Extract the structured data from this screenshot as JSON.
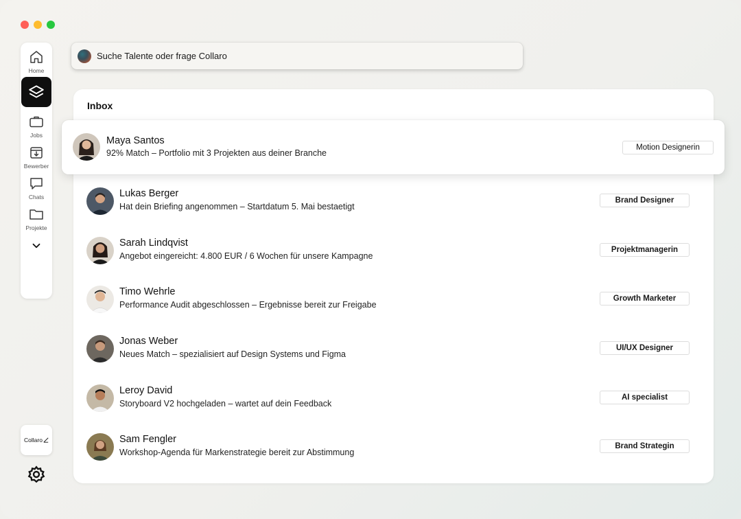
{
  "search": {
    "placeholder": "Suche Talente oder frage Collaro"
  },
  "sidebar": {
    "items": [
      {
        "label": "Home",
        "icon": "home-icon"
      },
      {
        "label": "",
        "icon": "layers-icon",
        "active": true
      },
      {
        "label": "Jobs",
        "icon": "briefcase-icon"
      },
      {
        "label": "Bewerber",
        "icon": "inbox-download-icon"
      },
      {
        "label": "Chats",
        "icon": "chat-icon"
      },
      {
        "label": "Projekte",
        "icon": "folder-icon"
      }
    ],
    "more_icon": "chevron-down-icon",
    "brand": "Collaro",
    "settings_icon": "gear-icon"
  },
  "inbox": {
    "title": "Inbox",
    "featured": {
      "name": "Maya Santos",
      "message": "92% Match – Portfolio mit 3 Projekten aus deiner Branche",
      "tag": "Motion Designerin"
    },
    "rows": [
      {
        "name": "Lukas Berger",
        "message": "Hat dein Briefing angenommen – Startdatum 5. Mai bestaetigt",
        "tag": "Brand Designer"
      },
      {
        "name": "Sarah Lindqvist",
        "message": "Angebot eingereicht: 4.800 EUR / 6 Wochen für unsere Kampagne",
        "tag": "Projektmanagerin"
      },
      {
        "name": "Timo Wehrle",
        "message": "Performance Audit abgeschlossen – Ergebnisse bereit zur Freigabe",
        "tag": "Growth Marketer"
      },
      {
        "name": "Jonas Weber",
        "message": "Neues Match – spezialisiert auf Design Systems und Figma",
        "tag": "UI/UX Designer"
      },
      {
        "name": "Leroy David",
        "message": "Storyboard V2 hochgeladen – wartet auf dein Feedback",
        "tag": "AI specialist"
      },
      {
        "name": "Sam Fengler",
        "message": "Workshop-Agenda für Markenstrategie bereit zur Abstimmung",
        "tag": "Brand Strategin"
      }
    ]
  },
  "colors": {
    "active_nav": "#0f0f0f",
    "panel": "#ffffff",
    "background": "#f0f0ed"
  }
}
